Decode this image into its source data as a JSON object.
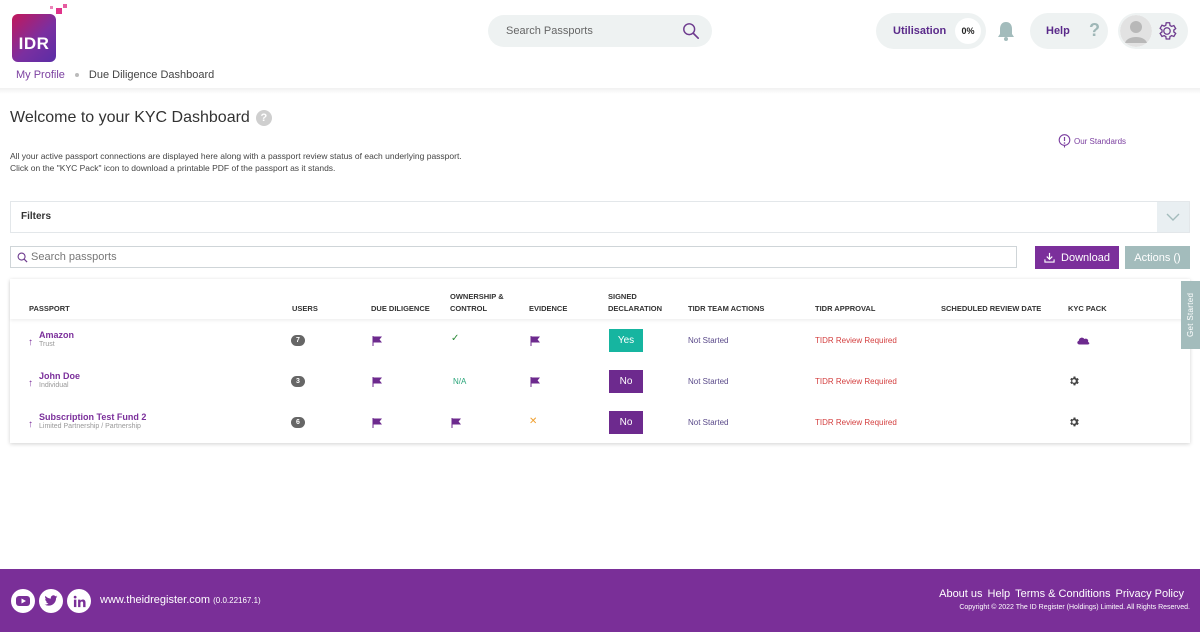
{
  "header": {
    "logo_text": "IDR",
    "search_placeholder": "Search Passports",
    "utilisation_label": "Utilisation",
    "utilisation_value": "0%",
    "help_label": "Help",
    "help_glyph": "?"
  },
  "breadcrumb": {
    "profile": "My Profile",
    "current": "Due Diligence Dashboard"
  },
  "page": {
    "title": "Welcome to your KYC Dashboard",
    "title_help_glyph": "?",
    "standards_link": "Our Standards",
    "intro_line1": "All your active passport connections are displayed here along with a passport review status of each underlying passport.",
    "intro_line2": "Click on the \"KYC Pack\" icon to download a printable PDF of the passport as it stands."
  },
  "filters": {
    "label": "Filters"
  },
  "toolbar": {
    "search_placeholder": "Search passports",
    "download_label": "Download",
    "actions_label": "Actions ()"
  },
  "table": {
    "headers": {
      "passport": "PASSPORT",
      "users": "USERS",
      "due_diligence": "DUE DILIGENCE",
      "ownership_line1": "OWNERSHIP &",
      "ownership_line2": "CONTROL",
      "evidence": "EVIDENCE",
      "signed_line1": "SIGNED",
      "signed_line2": "DECLARATION",
      "tidr_actions": "TIDR TEAM ACTIONS",
      "tidr_approval": "TIDR APPROVAL",
      "review_date": "SCHEDULED REVIEW DATE",
      "kyc_pack": "KYC PACK"
    },
    "rows": [
      {
        "name": "Amazon",
        "type": "Trust",
        "users": "7",
        "due_diligence": "flag",
        "ownership": "✓",
        "ownership_kind": "check",
        "evidence": "flag",
        "evidence_kind": "flag",
        "declaration": "Yes",
        "team_actions": "Not Started",
        "approval": "TIDR Review Required",
        "kyc_icon": "cloud-icon"
      },
      {
        "name": "John Doe",
        "type": "Individual",
        "users": "3",
        "due_diligence": "flag",
        "ownership": "N/A",
        "ownership_kind": "na",
        "evidence": "flag",
        "evidence_kind": "flag",
        "declaration": "No",
        "team_actions": "Not Started",
        "approval": "TIDR Review Required",
        "kyc_icon": "gear-icon"
      },
      {
        "name": "Subscription Test Fund 2",
        "type": "Limited Partnership / Partnership",
        "users": "6",
        "due_diligence": "flag",
        "ownership": "flag",
        "ownership_kind": "flag",
        "evidence": "✕",
        "evidence_kind": "x",
        "declaration": "No",
        "team_actions": "Not Started",
        "approval": "TIDR Review Required",
        "kyc_icon": "gear-icon"
      }
    ]
  },
  "side_tab": "Get Started",
  "footer": {
    "site": "www.theidregister.com",
    "version": "(0.0.22167.1)",
    "links": [
      "About us",
      "Help",
      "Terms & Conditions",
      "Privacy Policy"
    ],
    "copyright": "Copyright © 2022   The ID Register (Holdings) Limited. All Rights Reserved."
  },
  "colors": {
    "brand_purple": "#7b2f9b",
    "teal_yes": "#16b5a0",
    "approval_red": "#d44040",
    "footer_bg": "#7a2f98"
  }
}
